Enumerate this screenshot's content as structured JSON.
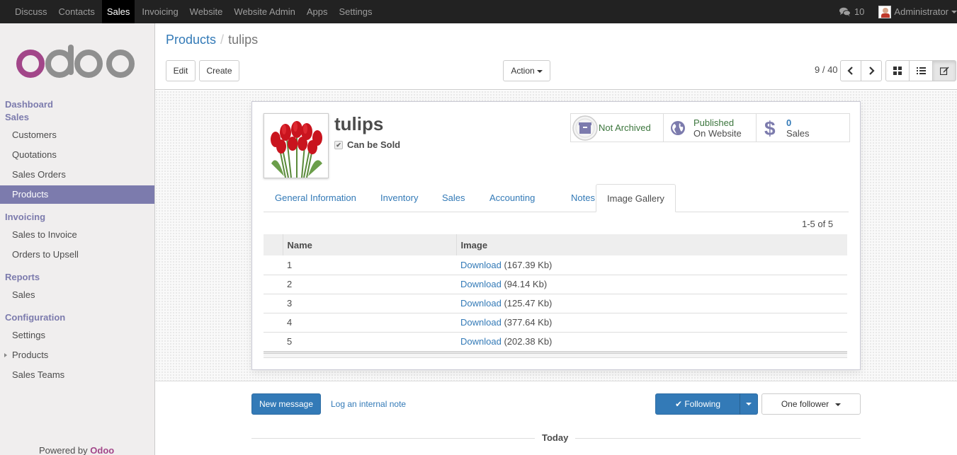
{
  "topbar": {
    "menu": [
      "Discuss",
      "Contacts",
      "Sales",
      "Invoicing",
      "Website",
      "Website Admin",
      "Apps",
      "Settings"
    ],
    "active_menu": "Sales",
    "messages_count": "10",
    "user_name": "Administrator"
  },
  "sidebar": {
    "headings": {
      "dashboard": "Dashboard",
      "sales": "Sales",
      "invoicing": "Invoicing",
      "reports": "Reports",
      "configuration": "Configuration"
    },
    "sales_items": [
      "Customers",
      "Quotations",
      "Sales Orders",
      "Products"
    ],
    "invoicing_items": [
      "Sales to Invoice",
      "Orders to Upsell"
    ],
    "reports_items": [
      "Sales"
    ],
    "config_items": [
      "Settings",
      "Products",
      "Sales Teams"
    ],
    "active_item": "Products",
    "powered_by": "Powered by",
    "powered_brand": "Odoo"
  },
  "control": {
    "breadcrumb_parent": "Products",
    "breadcrumb_sep": "/",
    "breadcrumb_current": "tulips",
    "edit_label": "Edit",
    "create_label": "Create",
    "action_label": "Action",
    "pager": "9 / 40"
  },
  "product": {
    "name": "tulips",
    "can_be_sold_label": "Can be Sold",
    "can_be_sold": true,
    "stat_archive": "Not Archived",
    "stat_published_line1": "Published",
    "stat_published_line2": "On Website",
    "stat_sales_count": "0",
    "stat_sales_label": "Sales"
  },
  "tabs": [
    "General Information",
    "Inventory",
    "Sales",
    "Accounting",
    "Notes",
    "Image Gallery"
  ],
  "active_tab": "Image Gallery",
  "gallery": {
    "pager": "1-5 of 5",
    "columns": [
      "Name",
      "Image"
    ],
    "rows": [
      {
        "name": "1",
        "link": "Download",
        "size": "(167.39 Kb)"
      },
      {
        "name": "2",
        "link": "Download",
        "size": "(94.14 Kb)"
      },
      {
        "name": "3",
        "link": "Download",
        "size": "(125.47 Kb)"
      },
      {
        "name": "4",
        "link": "Download",
        "size": "(377.64 Kb)"
      },
      {
        "name": "5",
        "link": "Download",
        "size": "(202.38 Kb)"
      }
    ]
  },
  "chatter": {
    "new_message": "New message",
    "log_note": "Log an internal note",
    "following": "Following",
    "followers": "One follower",
    "today": "Today"
  },
  "colors": {
    "brand_purple": "#7c7bad",
    "link_blue": "#337ab7",
    "odoo_logo_purple": "#a24689",
    "odoo_logo_grey": "#8f8f8f",
    "published_green": "#3c763d"
  },
  "icons": {
    "messages": "comments-icon",
    "archive": "archive-icon",
    "published": "globe-icon",
    "sales": "dollar-icon",
    "kanban": "th-large-icon",
    "list": "list-icon",
    "form": "edit-icon"
  }
}
